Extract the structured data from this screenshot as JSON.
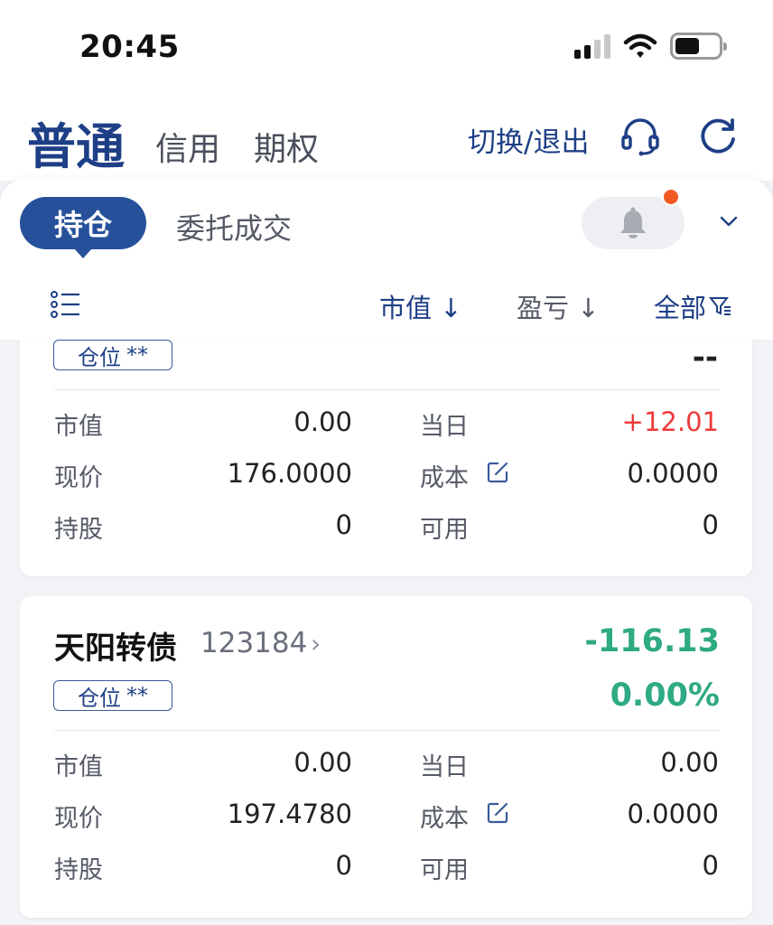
{
  "status_bar": {
    "time": "20:45"
  },
  "header": {
    "tabs": [
      {
        "label": "普通",
        "active": true
      },
      {
        "label": "信用",
        "active": false
      },
      {
        "label": "期权",
        "active": false
      }
    ],
    "switch_label": "切换/退出",
    "icons": [
      "headset-icon",
      "refresh-icon"
    ]
  },
  "segment": {
    "active_label": "持仓",
    "other_label": "委托成交",
    "bell_icon": "bell-icon",
    "dropdown_icon": "chevron-down-icon"
  },
  "sort_bar": {
    "list_icon": "list-icon",
    "market_label": "市值 ↓",
    "pnl_label": "盈亏 ↓",
    "filter_label": "全部",
    "filter_icon": "filter-icon"
  },
  "positions": [
    {
      "tag": "仓位",
      "tag_mask": "**",
      "pnl": "--",
      "market_value_label": "市值",
      "market_value": "0.00",
      "today_label": "当日",
      "today": "+12.01",
      "price_label": "现价",
      "price": "176.0000",
      "cost_label": "成本",
      "cost": "0.0000",
      "shares_label": "持股",
      "shares": "0",
      "available_label": "可用",
      "available": "0"
    },
    {
      "name": "天阳转债",
      "code": "123184",
      "arrow": "›",
      "tag": "仓位",
      "tag_mask": "**",
      "pnl": "-116.13",
      "pnl_pct": "0.00%",
      "market_value_label": "市值",
      "market_value": "0.00",
      "today_label": "当日",
      "today": "0.00",
      "price_label": "现价",
      "price": "197.4780",
      "cost_label": "成本",
      "cost": "0.0000",
      "shares_label": "持股",
      "shares": "0",
      "available_label": "可用",
      "available": "0"
    }
  ],
  "colors": {
    "brand": "#1e3f86",
    "active_pill": "#26519a",
    "up": "#ee3b3b",
    "down": "#2eaa84",
    "badge": "#f25a24"
  }
}
